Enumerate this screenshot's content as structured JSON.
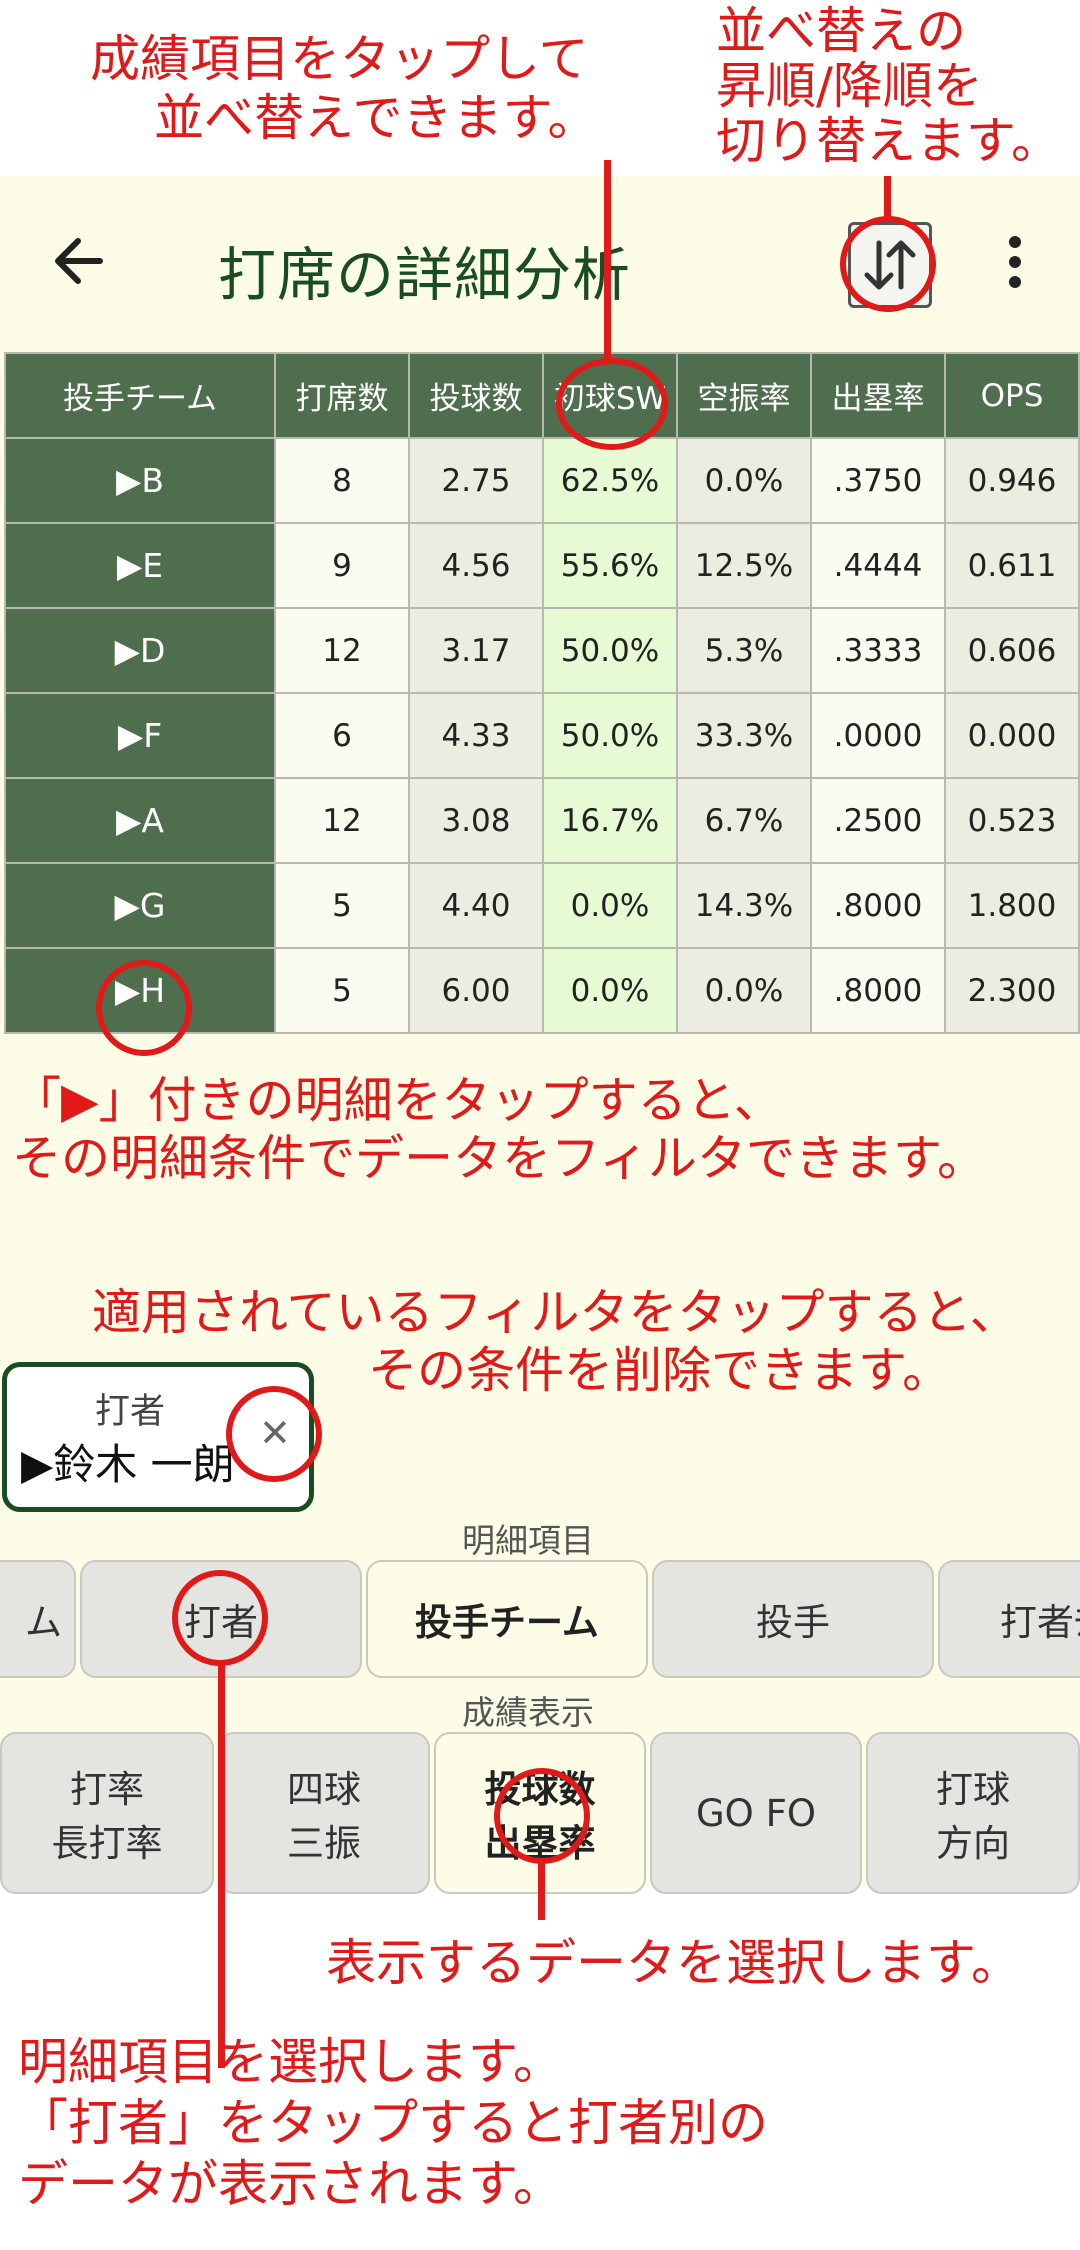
{
  "annotations": {
    "top_left_1": "成績項目をタップして",
    "top_left_2": "並べ替えできます。",
    "top_right_1": "並べ替えの",
    "top_right_2": "昇順/降順を",
    "top_right_3": "切り替えます。",
    "mid_1": "「▶」付きの明細をタップすると、",
    "mid_2": "その明細条件でデータをフィルタできます。",
    "filter_1": "適用されているフィルタをタップすると、",
    "filter_2": "その条件を削除できます。",
    "display": "表示するデータを選択します。",
    "bottom_1": "明細項目を選択します。",
    "bottom_2": "「打者」をタップすると打者別の",
    "bottom_3": "データが表示されます。"
  },
  "appbar": {
    "title": "打席の詳細分析",
    "back_icon": "arrow-left-icon",
    "sort_icon": "sort-toggle-icon",
    "more_icon": "more-vertical-icon"
  },
  "table": {
    "headers": [
      "投手チーム",
      "打席数",
      "投球数",
      "初球SW",
      "空振率",
      "出塁率",
      "OPS"
    ],
    "rows": [
      [
        "▶B",
        "8",
        "2.75",
        "62.5%",
        "0.0%",
        ".3750",
        "0.946"
      ],
      [
        "▶E",
        "9",
        "4.56",
        "55.6%",
        "12.5%",
        ".4444",
        "0.611"
      ],
      [
        "▶D",
        "12",
        "3.17",
        "50.0%",
        "5.3%",
        ".3333",
        "0.606"
      ],
      [
        "▶F",
        "6",
        "4.33",
        "50.0%",
        "33.3%",
        ".0000",
        "0.000"
      ],
      [
        "▶A",
        "12",
        "3.08",
        "16.7%",
        "6.7%",
        ".2500",
        "0.523"
      ],
      [
        "▶G",
        "5",
        "4.40",
        "0.0%",
        "14.3%",
        ".8000",
        "1.800"
      ],
      [
        "▶H",
        "5",
        "6.00",
        "0.0%",
        "0.0%",
        ".8000",
        "2.300"
      ]
    ]
  },
  "filter_chip": {
    "label": "打者",
    "value": "▶鈴木 一朗",
    "close_icon": "close-icon"
  },
  "detail_section": {
    "label": "明細項目",
    "tabs": [
      "ム",
      "打者",
      "投手チーム",
      "投手",
      "打者ﾁ"
    ]
  },
  "stats_section": {
    "label": "成績表示",
    "tabs": [
      {
        "l1": "打率",
        "l2": "長打率"
      },
      {
        "l1": "四球",
        "l2": "三振"
      },
      {
        "l1": "投球数",
        "l2": "出塁率"
      },
      {
        "l1": "GO FO",
        "l2": ""
      },
      {
        "l1": "打球",
        "l2": "方向"
      }
    ]
  },
  "colors": {
    "accent": "#e01919",
    "header_green": "#4f6e4e",
    "title_green": "#184d22",
    "bg": "#fdfde7"
  }
}
